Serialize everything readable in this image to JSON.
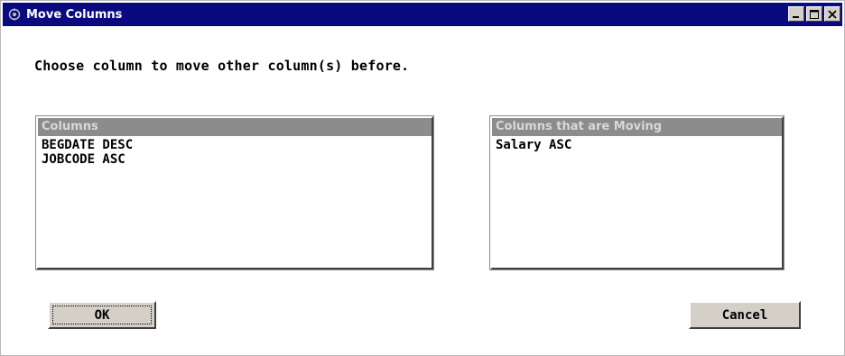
{
  "window": {
    "title": "Move Columns"
  },
  "instruction": "Choose column to move other column(s) before.",
  "left_list": {
    "header": "Columns",
    "items": [
      "BEGDATE DESC",
      "JOBCODE ASC"
    ]
  },
  "right_list": {
    "header": "Columns that are Moving",
    "items": [
      "Salary ASC"
    ]
  },
  "buttons": {
    "ok_label": "OK",
    "cancel_label": "Cancel"
  },
  "colors": {
    "titlebar": "#0a0a80",
    "list_header": "#8c8c8c",
    "button_face": "#d4d0c8"
  },
  "icons": [
    "app-icon",
    "minimize-icon",
    "maximize-icon",
    "close-icon"
  ]
}
